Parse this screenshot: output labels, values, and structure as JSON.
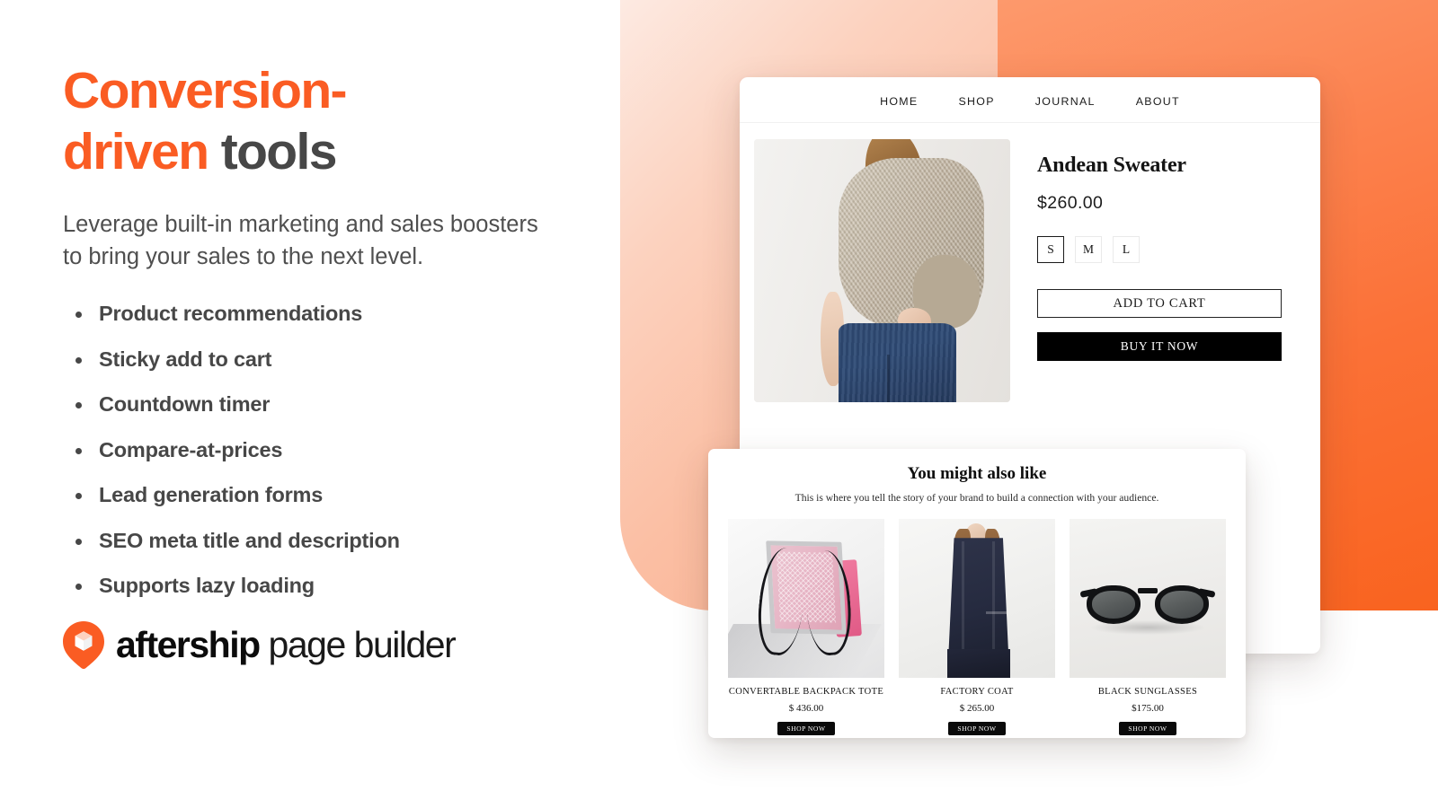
{
  "hero": {
    "headline_line1_orange": "Conversion-",
    "headline_line2_orange": "driven ",
    "headline_line2_dark": "tools",
    "subhead": "Leverage built-in marketing and sales boosters to bring your sales to the next level.",
    "features": [
      "Product recommendations",
      "Sticky add to cart",
      "Countdown timer",
      "Compare-at-prices",
      "Lead generation forms",
      "SEO meta title and description",
      "Supports lazy loading"
    ]
  },
  "logo": {
    "icon": "aftership-pin-cube-icon",
    "brand_bold": "aftership",
    "brand_light": " page builder"
  },
  "colors": {
    "accent_orange": "#fa5c23",
    "headline_dark": "#474747",
    "panel_orange_start": "#fd9a6d",
    "panel_orange_end": "#f9631f",
    "panel_peach_start": "#fdeae2",
    "panel_peach_end": "#f9ac8b"
  },
  "shop_mock": {
    "nav": [
      "HOME",
      "SHOP",
      "JOURNAL",
      "ABOUT"
    ],
    "product": {
      "image_alt": "woman-in-beige-knit-sweater-and-jeans",
      "title": "Andean Sweater",
      "price": "$260.00",
      "sizes": [
        {
          "label": "S",
          "selected": true
        },
        {
          "label": "M",
          "selected": false
        },
        {
          "label": "L",
          "selected": false
        }
      ],
      "add_to_cart_label": "ADD TO CART",
      "buy_now_label": "BUY IT NOW"
    }
  },
  "recommendation_card": {
    "title": "You might also like",
    "subtitle": "This is where you tell the story of your brand to build a connection with your audience.",
    "items": [
      {
        "image_alt": "convertable-backpack-tote",
        "name": "CONVERTABLE BACKPACK TOTE",
        "price": "$ 436.00",
        "cta": "SHOP NOW"
      },
      {
        "image_alt": "factory-coat",
        "name": "FACTORY COAT",
        "price": "$ 265.00",
        "cta": "SHOP NOW"
      },
      {
        "image_alt": "black-sunglasses",
        "name": "BLACK SUNGLASSES",
        "price": "$175.00",
        "cta": "SHOP NOW"
      }
    ]
  }
}
